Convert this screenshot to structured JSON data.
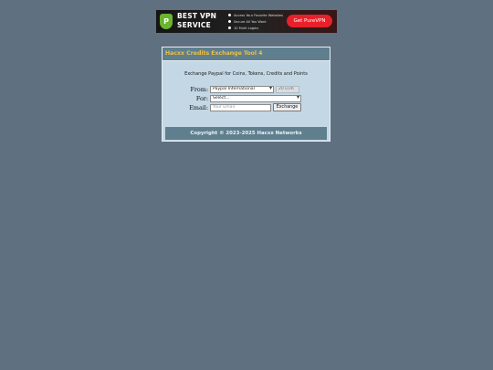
{
  "ad": {
    "logo_glyph": "P",
    "title_line1": "BEST VPN",
    "title_line2": "SERVICE",
    "features": [
      "Access Your Favorite Websites",
      "Secure All You Want",
      "10 Multi Logins"
    ],
    "cta": "Get PureVPN"
  },
  "panel": {
    "title": "Hacxx Credits Exchange Tool 4",
    "subtitle": "Exchange Paypal for Coins, Tokens, Credits and Points",
    "from_label": "From:",
    "from_value": "Paypal International",
    "amount_value": "20 EUR",
    "for_label": "For:",
    "for_value": "Select...",
    "email_label": "Email:",
    "email_placeholder": "Your Email",
    "exchange_button": "Exchange",
    "footer": "Copyright © 2023-2025 Hacxx Networks"
  },
  "colors": {
    "background": "#5f7080",
    "panel": "#c3d7e4",
    "header": "#5f7f8f",
    "title_text": "#f0c040",
    "ad_cta": "#e8202a"
  }
}
